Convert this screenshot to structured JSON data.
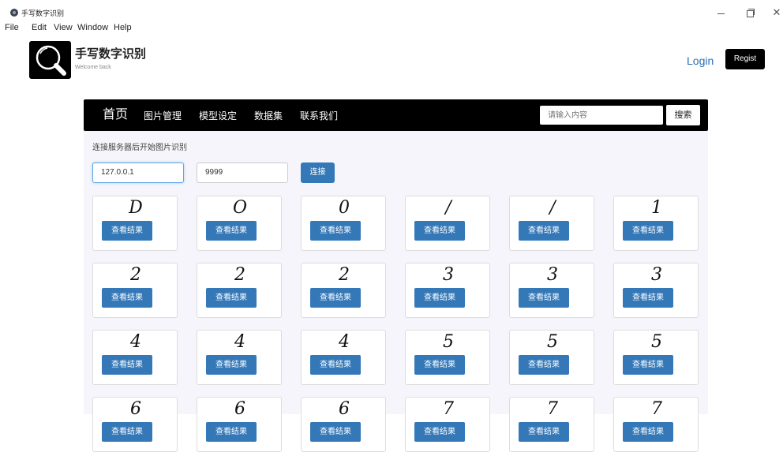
{
  "window": {
    "title": "手写数字识别",
    "menus": [
      "File",
      "Edit",
      "View",
      "Window",
      "Help"
    ]
  },
  "header": {
    "brand": "手写数字识别",
    "subtitle": "Welcome back",
    "login": "Login",
    "regist": "Regist",
    "logo_icon": "magnifier-icon"
  },
  "nav": {
    "items": [
      "首页",
      "图片管理",
      "模型设定",
      "数据集",
      "联系我们"
    ],
    "search_placeholder": "请输入内容",
    "search_button": "搜索"
  },
  "connection": {
    "hint": "连接服务器后开始图片识别",
    "ip": "127.0.0.1",
    "port": "9999",
    "connect_button": "连接"
  },
  "cards": {
    "button_label": "查看结果",
    "digits": [
      [
        "D",
        "O",
        "0",
        "/",
        "/",
        "1"
      ],
      [
        "2",
        "2",
        "2",
        "3",
        "3",
        "3"
      ],
      [
        "4",
        "4",
        "4",
        "5",
        "5",
        "5"
      ],
      [
        "6",
        "6",
        "6",
        "7",
        "7",
        "7"
      ]
    ]
  },
  "colors": {
    "primary": "#3478b8",
    "navbar": "#000000",
    "panel_bg": "#f5f5fb"
  }
}
